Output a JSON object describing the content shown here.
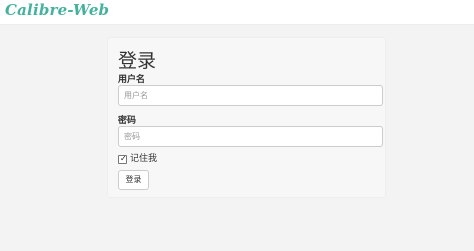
{
  "navbar": {
    "brand": "Calibre-Web"
  },
  "login": {
    "title": "登录",
    "username_label": "用户名",
    "username_placeholder": "用户名",
    "username_value": "",
    "password_label": "密码",
    "password_placeholder": "密码",
    "password_value": "",
    "remember_label": "记住我",
    "remember_checked": true,
    "submit_label": "登录"
  },
  "colors": {
    "brand": "#45b29d",
    "page_background": "#f3f3f3"
  }
}
